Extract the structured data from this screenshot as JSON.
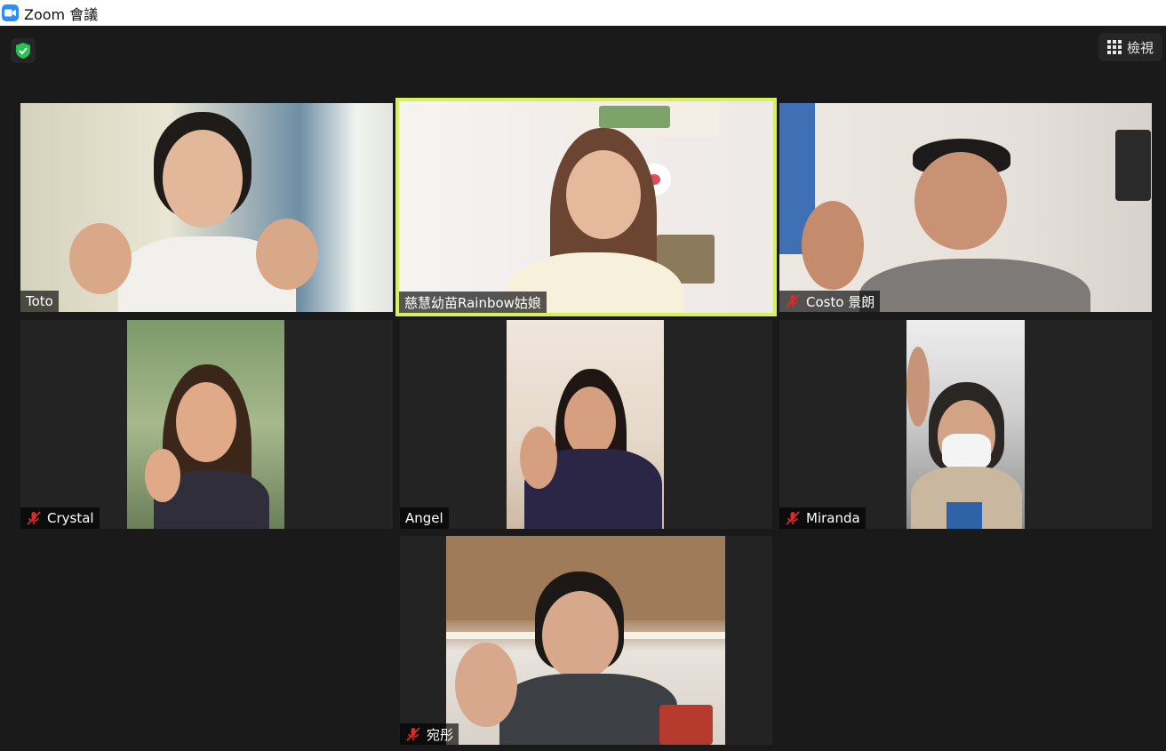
{
  "window": {
    "title": "Zoom 會議"
  },
  "toolbar": {
    "view_label": "檢視"
  },
  "participants": [
    {
      "name": "Toto",
      "muted": false,
      "active": false
    },
    {
      "name": "慈慧幼苗Rainbow姑娘",
      "muted": false,
      "active": true
    },
    {
      "name": "Costo 景朗",
      "muted": true,
      "active": false
    },
    {
      "name": "Crystal",
      "muted": true,
      "active": false
    },
    {
      "name": "Angel",
      "muted": false,
      "active": false
    },
    {
      "name": "Miranda",
      "muted": true,
      "active": false
    },
    {
      "name": "宛彤",
      "muted": true,
      "active": false
    }
  ],
  "colors": {
    "active_border": "#d8f05a",
    "mute_red": "#e02828",
    "shield_green": "#23c552",
    "zoom_blue": "#2d8cff"
  }
}
